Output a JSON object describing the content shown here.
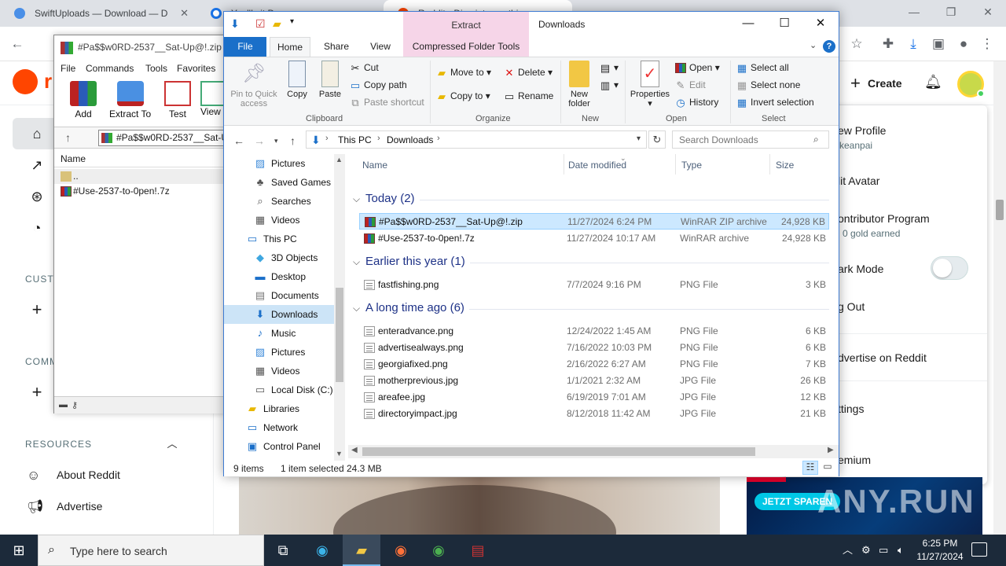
{
  "chrome": {
    "tabs": [
      {
        "title": "SwiftUploads — Download — D"
      },
      {
        "title": "You'll sit Dow"
      },
      {
        "title": "Reddit - Dive into anything"
      }
    ]
  },
  "reddit": {
    "logo_text": "r",
    "create_label": "Create",
    "left": {
      "custom_label": "CUSTO",
      "communities_label": "COMM",
      "resources_label": "RESOURCES",
      "resources_items": [
        "About Reddit",
        "Advertise"
      ]
    },
    "menu": {
      "view_profile": "ew Profile",
      "username": "keanpai",
      "edit_avatar": "lit Avatar",
      "contributor": "ontributor Program",
      "gold": "0 gold earned",
      "dark_mode": "ark Mode",
      "log_out": "g Out",
      "advertise": "dvertise on Reddit",
      "settings": "ttings",
      "premium": "emium"
    },
    "ad_button": "JETZT SPAREN",
    "watermark": "ANY.RUN"
  },
  "winrar": {
    "title": "#Pa$$w0RD-2537__Sat-Up@!.zip",
    "menu": [
      "File",
      "Commands",
      "Tools",
      "Favorites"
    ],
    "tools": [
      "Add",
      "Extract To",
      "Test",
      "View"
    ],
    "address": "#Pa$$w0RD-2537__Sat-Up@!.zip",
    "column": "Name",
    "rows": [
      "..",
      "#Use-2537-to-0pen!.7z"
    ]
  },
  "explorer": {
    "title": "Downloads",
    "context_tab": "Extract",
    "tabs": {
      "file": "File",
      "home": "Home",
      "share": "Share",
      "view": "View",
      "compressed": "Compressed Folder Tools"
    },
    "ribbon": {
      "pin": "Pin to Quick access",
      "copy": "Copy",
      "paste": "Paste",
      "cut": "Cut",
      "copy_path": "Copy path",
      "paste_shortcut": "Paste shortcut",
      "clipboard": "Clipboard",
      "move_to": "Move to",
      "copy_to": "Copy to",
      "delete": "Delete",
      "rename": "Rename",
      "organize": "Organize",
      "new_folder": "New folder",
      "new": "New",
      "properties": "Properties",
      "open": "Open",
      "edit": "Edit",
      "history": "History",
      "open_group": "Open",
      "select_all": "Select all",
      "select_none": "Select none",
      "invert_selection": "Invert selection",
      "select": "Select"
    },
    "breadcrumb": [
      "This PC",
      "Downloads"
    ],
    "search_placeholder": "Search Downloads",
    "nav": [
      {
        "label": "Pictures",
        "icon": "pictures-icon"
      },
      {
        "label": "Saved Games",
        "icon": "saved-games-icon"
      },
      {
        "label": "Searches",
        "icon": "searches-icon"
      },
      {
        "label": "Videos",
        "icon": "videos-icon"
      },
      {
        "label": "This PC",
        "icon": "computer-icon"
      },
      {
        "label": "3D Objects",
        "icon": "3d-objects-icon"
      },
      {
        "label": "Desktop",
        "icon": "desktop-icon"
      },
      {
        "label": "Documents",
        "icon": "documents-icon"
      },
      {
        "label": "Downloads",
        "icon": "downloads-icon"
      },
      {
        "label": "Music",
        "icon": "music-icon"
      },
      {
        "label": "Pictures",
        "icon": "pictures-icon"
      },
      {
        "label": "Videos",
        "icon": "videos-icon"
      },
      {
        "label": "Local Disk (C:)",
        "icon": "disk-icon"
      },
      {
        "label": "Libraries",
        "icon": "libraries-icon"
      },
      {
        "label": "Network",
        "icon": "network-icon"
      },
      {
        "label": "Control Panel",
        "icon": "control-panel-icon"
      }
    ],
    "columns": [
      "Name",
      "Date modified",
      "Type",
      "Size"
    ],
    "groups": [
      {
        "label": "Today (2)",
        "files": [
          {
            "name": "#Pa$$w0RD-2537__Sat-Up@!.zip",
            "date": "11/27/2024 6:24 PM",
            "type": "WinRAR ZIP archive",
            "size": "24,928 KB"
          },
          {
            "name": "#Use-2537-to-0pen!.7z",
            "date": "11/27/2024 10:17 AM",
            "type": "WinRAR archive",
            "size": "24,928 KB"
          }
        ]
      },
      {
        "label": "Earlier this year (1)",
        "files": [
          {
            "name": "fastfishing.png",
            "date": "7/7/2024 9:16 PM",
            "type": "PNG File",
            "size": "3 KB"
          }
        ]
      },
      {
        "label": "A long time ago (6)",
        "files": [
          {
            "name": "enteradvance.png",
            "date": "12/24/2022 1:45 AM",
            "type": "PNG File",
            "size": "6 KB"
          },
          {
            "name": "advertisealways.png",
            "date": "7/16/2022 10:03 PM",
            "type": "PNG File",
            "size": "6 KB"
          },
          {
            "name": "georgiafixed.png",
            "date": "2/16/2022 6:27 AM",
            "type": "PNG File",
            "size": "7 KB"
          },
          {
            "name": "motherprevious.jpg",
            "date": "1/1/2021 2:32 AM",
            "type": "JPG File",
            "size": "26 KB"
          },
          {
            "name": "areafee.jpg",
            "date": "6/19/2019 7:01 AM",
            "type": "JPG File",
            "size": "12 KB"
          },
          {
            "name": "directoryimpact.jpg",
            "date": "8/12/2018 11:42 AM",
            "type": "JPG File",
            "size": "21 KB"
          }
        ]
      }
    ],
    "status": {
      "count": "9 items",
      "selected": "1 item selected",
      "size": "24.3 MB"
    }
  },
  "taskbar": {
    "search_placeholder": "Type here to search",
    "time": "6:25 PM",
    "date": "11/27/2024"
  }
}
